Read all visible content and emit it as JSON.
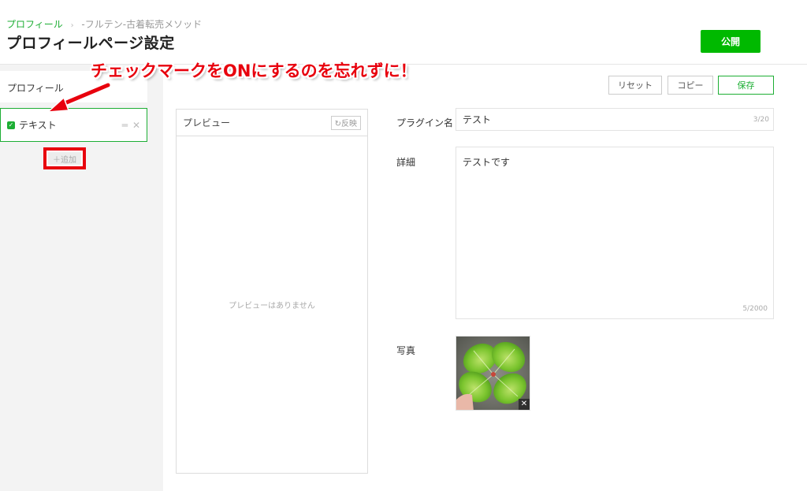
{
  "header": {
    "breadcrumb": {
      "link": "プロフィール",
      "separator": "›",
      "current": "-フルテン-古着転売メソッド"
    },
    "title": "プロフィールページ設定",
    "publish_label": "公開"
  },
  "sidebar": {
    "items": [
      {
        "label": "プロフィール"
      },
      {
        "label": "テキスト",
        "checked": true
      }
    ],
    "add_label": "＋追加"
  },
  "annotation": {
    "text": "チェックマークをONにするのを忘れずに！",
    "color": "#e8000d"
  },
  "toolbar": {
    "reset_label": "リセット",
    "copy_label": "コピー",
    "save_label": "保存"
  },
  "preview": {
    "title": "プレビュー",
    "reflect_label": "↻反映",
    "empty_text": "プレビューはありません"
  },
  "form": {
    "plugin_name_label": "プラグイン名",
    "plugin_name_value": "テスト",
    "plugin_name_count": "3/20",
    "detail_label": "詳細",
    "detail_value": "テストです",
    "detail_count": "5/2000",
    "photo_label": "写真",
    "photo_remove": "✕"
  },
  "colors": {
    "accent": "#00b900",
    "highlight": "#e8000d"
  }
}
